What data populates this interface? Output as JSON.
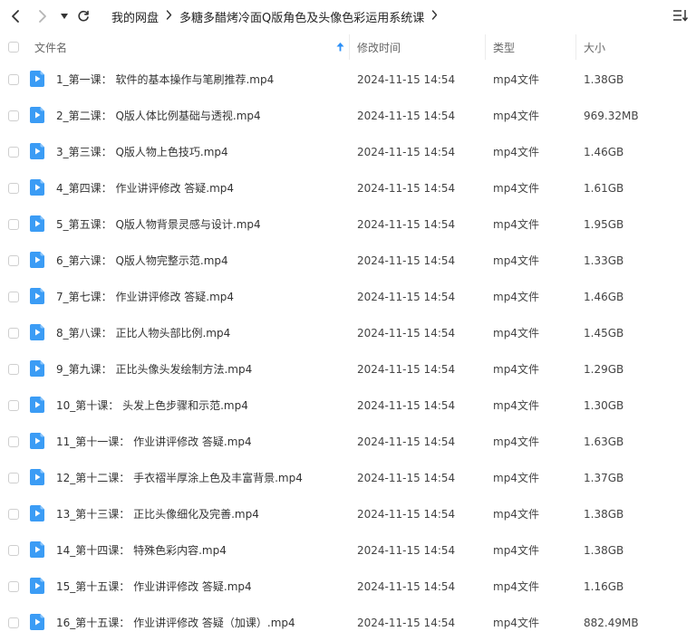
{
  "breadcrumb": [
    {
      "label": "我的网盘"
    },
    {
      "label": "多糖多醋烤冷面Q版角色及头像色彩运用系统课"
    }
  ],
  "columns": {
    "name": "文件名",
    "modified": "修改时间",
    "type": "类型",
    "size": "大小"
  },
  "files": [
    {
      "name": "1_第一课： 软件的基本操作与笔刷推荐.mp4",
      "modified": "2024-11-15 14:54",
      "type": "mp4文件",
      "size": "1.38GB"
    },
    {
      "name": "2_第二课： Q版人体比例基础与透视.mp4",
      "modified": "2024-11-15 14:54",
      "type": "mp4文件",
      "size": "969.32MB"
    },
    {
      "name": "3_第三课： Q版人物上色技巧.mp4",
      "modified": "2024-11-15 14:54",
      "type": "mp4文件",
      "size": "1.46GB"
    },
    {
      "name": "4_第四课： 作业讲评修改 答疑.mp4",
      "modified": "2024-11-15 14:54",
      "type": "mp4文件",
      "size": "1.61GB"
    },
    {
      "name": "5_第五课： Q版人物背景灵感与设计.mp4",
      "modified": "2024-11-15 14:54",
      "type": "mp4文件",
      "size": "1.95GB"
    },
    {
      "name": "6_第六课： Q版人物完整示范.mp4",
      "modified": "2024-11-15 14:54",
      "type": "mp4文件",
      "size": "1.33GB"
    },
    {
      "name": "7_第七课： 作业讲评修改 答疑.mp4",
      "modified": "2024-11-15 14:54",
      "type": "mp4文件",
      "size": "1.46GB"
    },
    {
      "name": "8_第八课： 正比人物头部比例.mp4",
      "modified": "2024-11-15 14:54",
      "type": "mp4文件",
      "size": "1.45GB"
    },
    {
      "name": "9_第九课： 正比头像头发绘制方法.mp4",
      "modified": "2024-11-15 14:54",
      "type": "mp4文件",
      "size": "1.29GB"
    },
    {
      "name": "10_第十课： 头发上色步骤和示范.mp4",
      "modified": "2024-11-15 14:54",
      "type": "mp4文件",
      "size": "1.30GB"
    },
    {
      "name": "11_第十一课： 作业讲评修改 答疑.mp4",
      "modified": "2024-11-15 14:54",
      "type": "mp4文件",
      "size": "1.63GB"
    },
    {
      "name": "12_第十二课： 手衣褶半厚涂上色及丰富背景.mp4",
      "modified": "2024-11-15 14:54",
      "type": "mp4文件",
      "size": "1.37GB"
    },
    {
      "name": "13_第十三课： 正比头像细化及完善.mp4",
      "modified": "2024-11-15 14:54",
      "type": "mp4文件",
      "size": "1.38GB"
    },
    {
      "name": "14_第十四课： 特殊色彩内容.mp4",
      "modified": "2024-11-15 14:54",
      "type": "mp4文件",
      "size": "1.38GB"
    },
    {
      "name": "15_第十五课： 作业讲评修改 答疑.mp4",
      "modified": "2024-11-15 14:54",
      "type": "mp4文件",
      "size": "1.16GB"
    },
    {
      "name": "16_第十五课： 作业讲评修改 答疑（加课）.mp4",
      "modified": "2024-11-15 14:54",
      "type": "mp4文件",
      "size": "882.49MB"
    }
  ],
  "icons": {
    "back": "chevron-left-icon",
    "forward": "chevron-right-icon",
    "history": "caret-down-icon",
    "refresh": "refresh-icon",
    "sort": "sort-list-icon",
    "sort_arrow": "arrow-up-icon",
    "file": "video-file-icon"
  },
  "colors": {
    "accent": "#2b8ff7",
    "file_icon": "#3b9cf5",
    "header_text": "#666666",
    "divider": "#ececec"
  }
}
